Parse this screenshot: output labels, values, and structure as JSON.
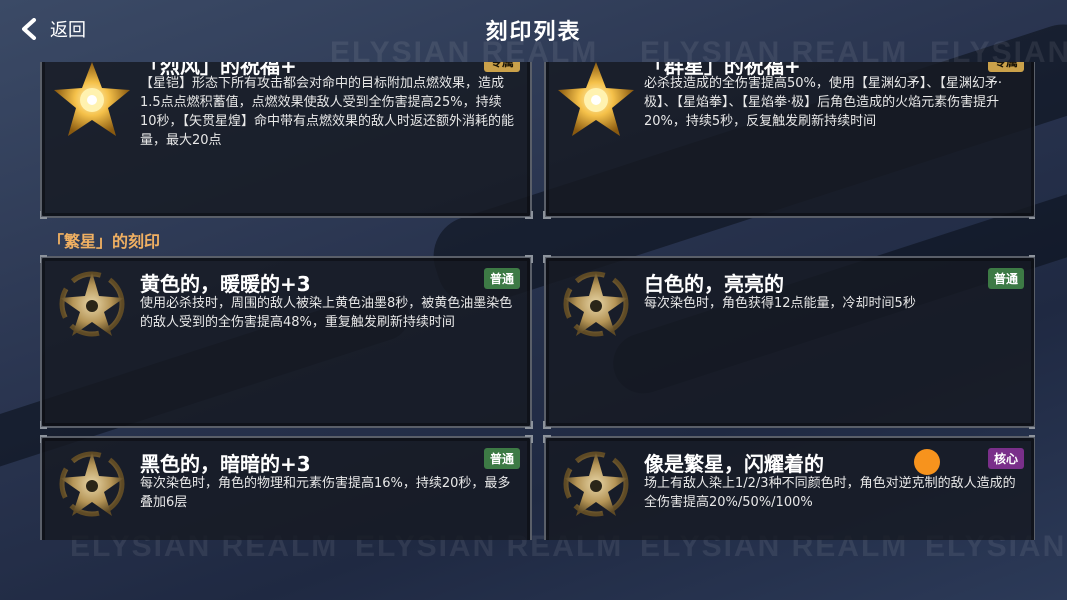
{
  "header": {
    "back_label": "返回",
    "title": "刻印列表"
  },
  "watermark_text": "ELYSIAN REALM",
  "top_cards": [
    {
      "name": "「烈风」的祝福+",
      "badge": "专属",
      "desc": "【星铠】形态下所有攻击都会对命中的目标附加点燃效果，造成1.5点点燃积蓄值，点燃效果使敌人受到全伤害提高25%，持续10秒，【矢贯星煌】命中带有点燃效果的敌人时返还额外消耗的能量，最大20点"
    },
    {
      "name": "「群星」的祝福+",
      "badge": "专属",
      "desc": "必杀技造成的全伤害提高50%，使用【星渊幻矛】、【星渊幻矛·极】、【星焰拳】、【星焰拳·极】后角色造成的火焰元素伤害提升20%，持续5秒，反复触发刷新持续时间"
    }
  ],
  "section_title": "「繁星」的刻印",
  "cards": [
    {
      "name": "黄色的，暖暖的+3",
      "badge": "普通",
      "desc": "使用必杀技时，周围的敌人被染上黄色油墨8秒，被黄色油墨染色的敌人受到的全伤害提高48%，重复触发刷新持续时间"
    },
    {
      "name": "白色的，亮亮的",
      "badge": "普通",
      "desc": "每次染色时，角色获得12点能量，冷却时间5秒"
    },
    {
      "name": "黑色的，暗暗的+3",
      "badge": "普通",
      "desc": "每次染色时，角色的物理和元素伤害提高16%，持续20秒，最多叠加6层"
    },
    {
      "name": "像是繁星，闪耀着的",
      "badge": "核心",
      "desc": "场上有敌人染上1/2/3种不同颜色时，角色对逆克制的敌人造成的全伤害提高20%/50%/100%"
    }
  ],
  "colors": {
    "section": "#f0b062",
    "badge_normal": "#3d7a45",
    "badge_exclusive": "#caa14a",
    "badge_core": "#7a2f8a",
    "accent_dot": "#f7931d"
  }
}
